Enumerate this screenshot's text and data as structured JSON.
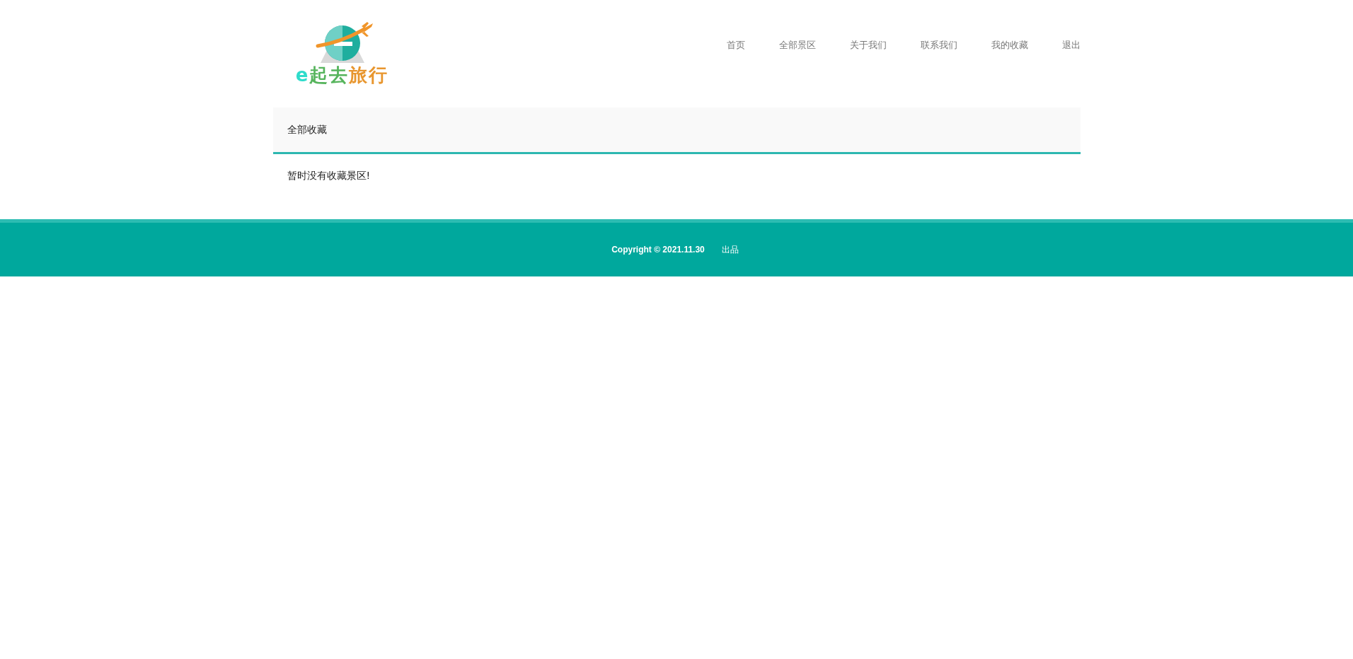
{
  "logo": {
    "parts": [
      {
        "text": "e",
        "color": "#2fdccb"
      },
      {
        "text": "起去",
        "color": "#56b45c"
      },
      {
        "text": "旅行",
        "color": "#e8962e"
      }
    ]
  },
  "nav": [
    {
      "label": "首页"
    },
    {
      "label": "全部景区"
    },
    {
      "label": "关于我们"
    },
    {
      "label": "联系我们"
    },
    {
      "label": "我的收藏"
    },
    {
      "label": "退出"
    }
  ],
  "panel": {
    "title": "全部收藏",
    "message": "暂时没有收藏景区!"
  },
  "footer": {
    "copyright": "Copyright © 2021.11.30",
    "credit": "出品"
  }
}
